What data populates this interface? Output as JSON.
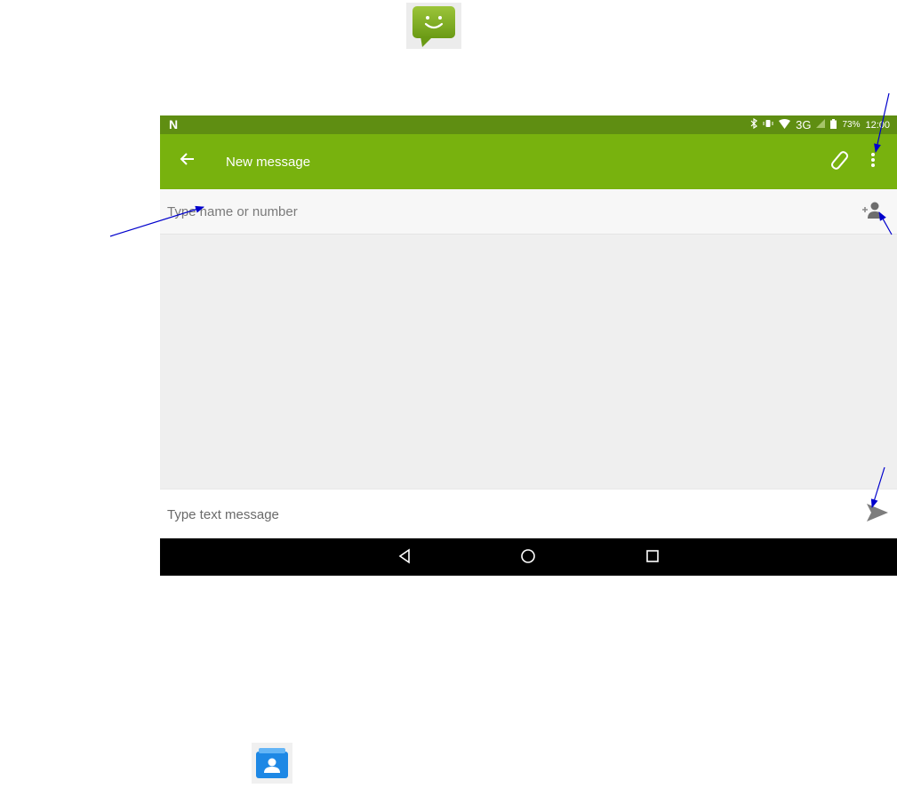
{
  "icons": {
    "messaging_app": "messaging-app-icon",
    "contacts_app": "contacts-app-icon"
  },
  "status_bar": {
    "carrier_glyph": "N",
    "network": "3G",
    "battery": "73%",
    "time": "12:00"
  },
  "app_bar": {
    "title": "New message"
  },
  "recipient": {
    "placeholder": "Type name or number",
    "value": ""
  },
  "compose": {
    "placeholder": "Type text message",
    "value": ""
  },
  "colors": {
    "status_bar": "#5f8e12",
    "app_bar": "#78b20e",
    "annotation_arrow": "#0000cc",
    "nav_bar": "#000000"
  }
}
